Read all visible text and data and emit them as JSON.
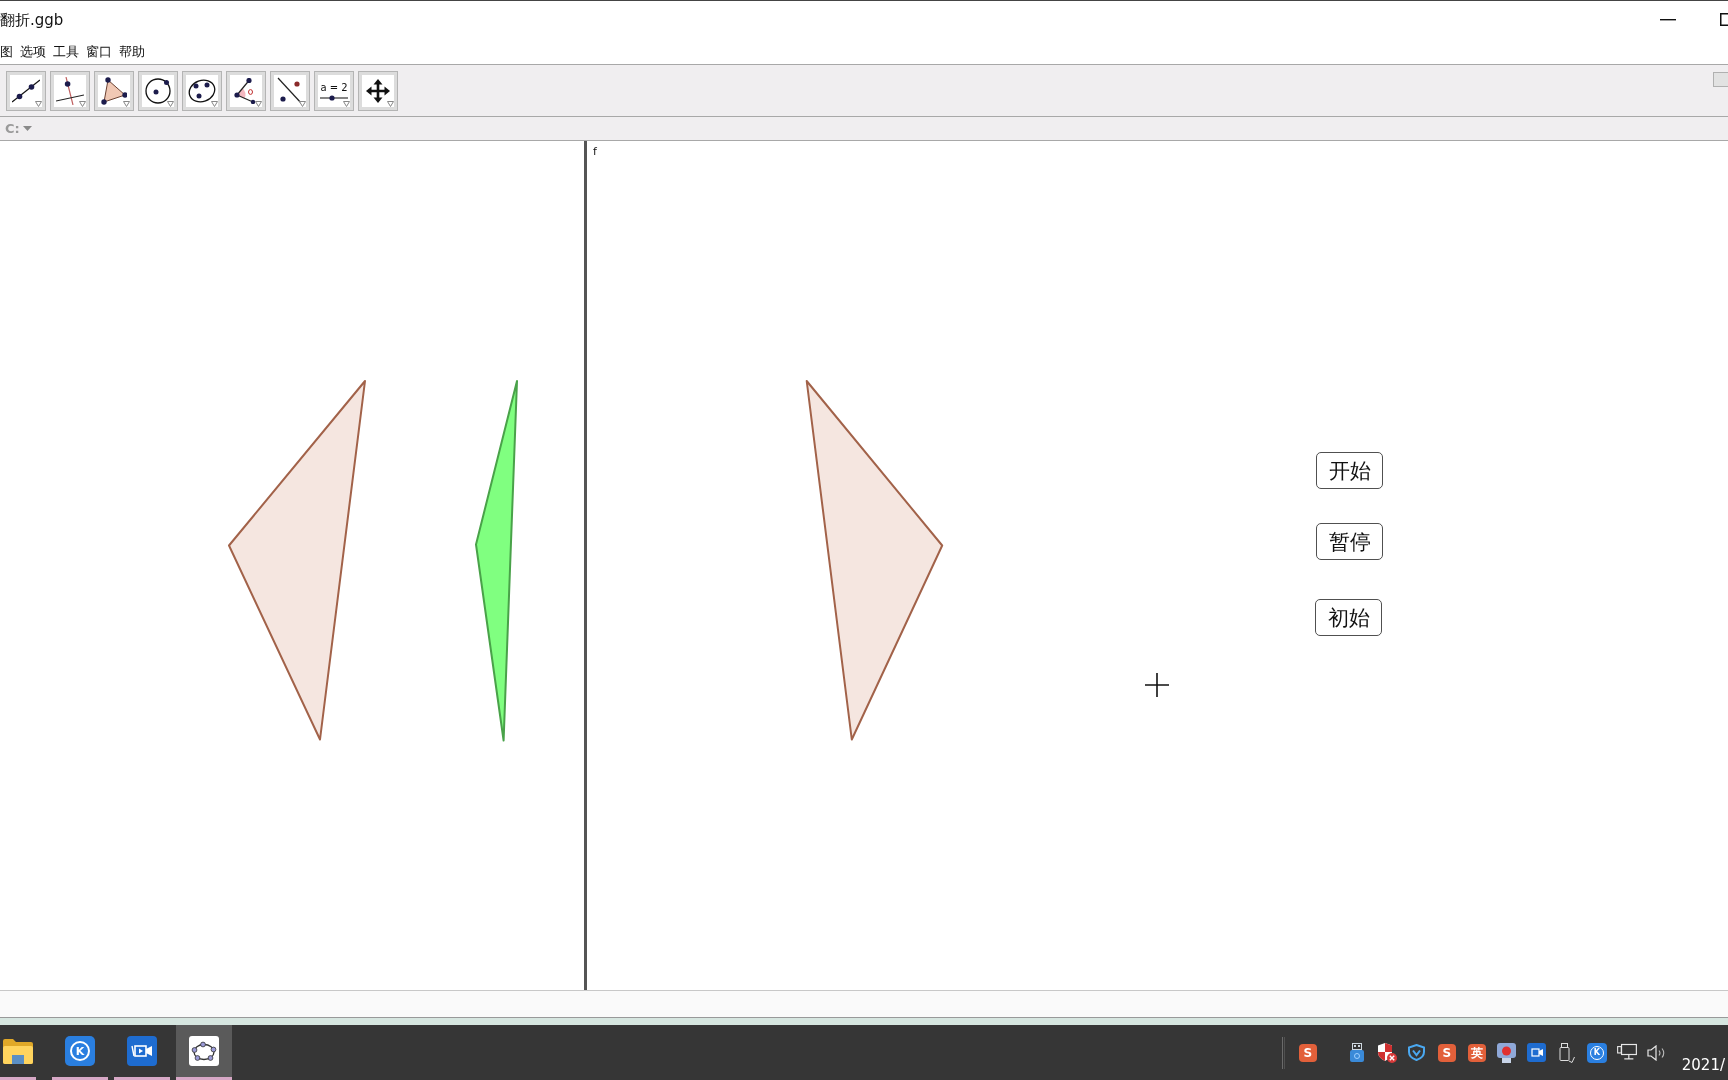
{
  "window": {
    "title": "翻折.ggb"
  },
  "menu": [
    "图",
    "选项",
    "工具",
    "窗口",
    "帮助"
  ],
  "toolbar": {
    "tools": [
      {
        "kind": "line"
      },
      {
        "kind": "perpendicular"
      },
      {
        "kind": "polygon"
      },
      {
        "kind": "circle"
      },
      {
        "kind": "conic"
      },
      {
        "kind": "angle"
      },
      {
        "kind": "reflect"
      },
      {
        "kind": "slider",
        "label": "a = 2"
      },
      {
        "kind": "move_view"
      }
    ]
  },
  "input_bar": {
    "label": "C:"
  },
  "graphics_left": {
    "shapes": [
      {
        "kind": "triangle",
        "color": "#f5e6e0"
      },
      {
        "kind": "triangle",
        "color": "#80ff80"
      }
    ]
  },
  "graphics_right": {
    "label": "f",
    "shapes": [
      {
        "kind": "triangle",
        "color": "#f5e6e0"
      }
    ],
    "buttons": [
      {
        "label": "开始"
      },
      {
        "label": "暂停"
      },
      {
        "label": "初始"
      }
    ]
  },
  "taskbar": {
    "apps": [
      {
        "kind": "folder",
        "selected": false
      },
      {
        "kind": "app_k",
        "glyph": "K",
        "selected": false
      },
      {
        "kind": "video",
        "selected": false
      },
      {
        "kind": "geogebra",
        "selected": true
      }
    ],
    "tray": [
      {
        "kind": "ime",
        "glyph": "S"
      },
      {
        "kind": "usb"
      },
      {
        "kind": "security"
      },
      {
        "kind": "shield"
      },
      {
        "kind": "ime",
        "glyph": "S"
      },
      {
        "kind": "ime",
        "glyph": "英"
      },
      {
        "kind": "record"
      },
      {
        "kind": "video"
      },
      {
        "kind": "drive"
      },
      {
        "kind": "app_k",
        "glyph": "K"
      },
      {
        "kind": "network"
      },
      {
        "kind": "volume"
      }
    ],
    "clock": "2021/"
  }
}
